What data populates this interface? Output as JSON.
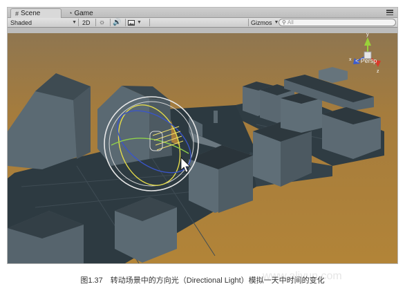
{
  "tabs": [
    {
      "label": "Scene",
      "icon": "scene-grid-icon",
      "active": true
    },
    {
      "label": "Game",
      "icon": "game-pacman-icon",
      "active": false
    }
  ],
  "toolbar": {
    "shading_mode": "Shaded",
    "mode_2d": "2D",
    "gizmos_label": "Gizmos",
    "search_placeholder": "All"
  },
  "viewport": {
    "projection_label": "< Persp",
    "gizmo_axes": [
      "y",
      "x",
      "z"
    ],
    "colors": {
      "ground": "#a57c3d",
      "sky": "#bdbdbd",
      "building": "#56646d",
      "light_gizmo": "#f3e36a"
    }
  },
  "caption": "图1.37　转动场景中的方向光（Directional Light）模拟一天中时间的变化",
  "watermark": "www.aliyun.com"
}
